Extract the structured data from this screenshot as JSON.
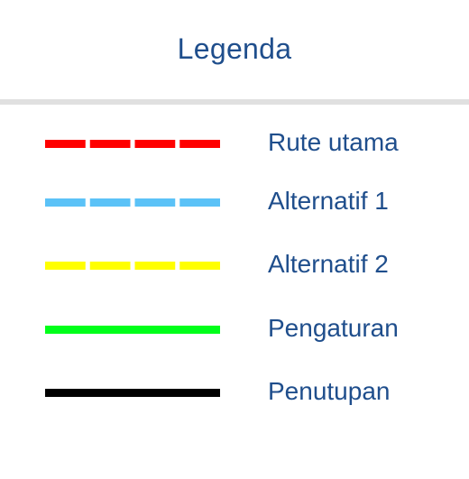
{
  "legend": {
    "title": "Legenda",
    "items": [
      {
        "label": "Rute utama",
        "color": "#ff0000",
        "style": "dashed",
        "icon": "red-dashed-line-icon"
      },
      {
        "label": "Alternatif 1",
        "color": "#5bc2f7",
        "style": "dashed",
        "icon": "light-blue-dashed-line-icon"
      },
      {
        "label": "Alternatif 2",
        "color": "#ffff00",
        "style": "dashed",
        "icon": "yellow-dashed-line-icon"
      },
      {
        "label": "Pengaturan",
        "color": "#00ff1a",
        "style": "solid",
        "icon": "green-solid-line-icon"
      },
      {
        "label": "Penutupan",
        "color": "#000000",
        "style": "solid",
        "icon": "black-solid-line-icon"
      }
    ]
  }
}
